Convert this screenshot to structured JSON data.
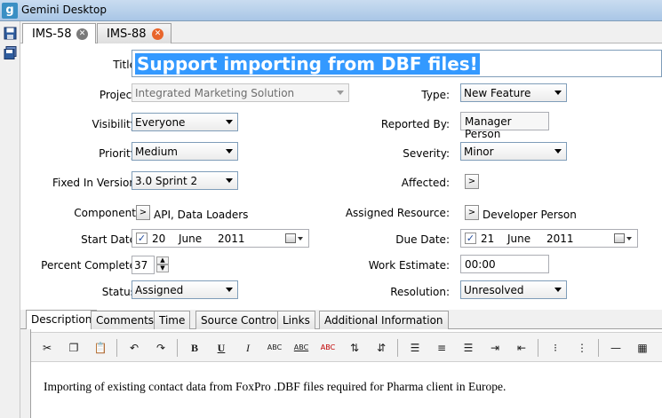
{
  "window": {
    "title": "Gemini Desktop",
    "logo_letter": "g"
  },
  "doc_tabs": [
    {
      "label": "IMS-58",
      "active": true
    },
    {
      "label": "IMS-88",
      "active": false
    }
  ],
  "form": {
    "title_label": "Title:",
    "title_value": "Support importing from DBF files!",
    "project": {
      "label": "Project:",
      "value": "Integrated Marketing Solution"
    },
    "type": {
      "label": "Type:",
      "value": "New Feature"
    },
    "visibility": {
      "label": "Visibility:",
      "value": "Everyone"
    },
    "reported_by": {
      "label": "Reported By:",
      "value": "Manager Person"
    },
    "priority": {
      "label": "Priority:",
      "value": "Medium"
    },
    "severity": {
      "label": "Severity:",
      "value": "Minor"
    },
    "fixed_in_version": {
      "label": "Fixed In Version:",
      "value": "3.0 Sprint 2"
    },
    "affected": {
      "label": "Affected:",
      "button": ">"
    },
    "component": {
      "label": "Component:",
      "button": ">",
      "value": "API, Data Loaders"
    },
    "assigned_resource": {
      "label": "Assigned Resource:",
      "button": ">",
      "value": "Developer Person"
    },
    "start_date": {
      "label": "Start Date:",
      "checked": "✓",
      "day": "20",
      "month": "June",
      "year": "2011"
    },
    "due_date": {
      "label": "Due Date:",
      "checked": "✓",
      "day": "21",
      "month": "June",
      "year": "2011"
    },
    "percent_complete": {
      "label": "Percent Complete:",
      "value": "37"
    },
    "work_estimate": {
      "label": "Work Estimate:",
      "value": "00:00"
    },
    "status": {
      "label": "Status:",
      "value": "Assigned"
    },
    "resolution": {
      "label": "Resolution:",
      "value": "Unresolved"
    }
  },
  "sub_tabs": [
    {
      "label": "Description",
      "active": true
    },
    {
      "label": "Comments",
      "active": false
    },
    {
      "label": "Time",
      "active": false
    },
    {
      "label": "Source Control",
      "active": false
    },
    {
      "label": "Links",
      "active": false
    },
    {
      "label": "Additional Information",
      "active": false
    }
  ],
  "toolbar": {
    "icons": [
      "cut-icon",
      "copy-icon",
      "paste-icon",
      "undo-icon",
      "redo-icon",
      "bold-icon",
      "underline-icon",
      "italic-icon",
      "strikethrough-icon",
      "font-color-icon",
      "highlight-icon",
      "sort-ascending-icon",
      "sort-descending-icon",
      "align-left-icon",
      "align-center-icon",
      "align-right-icon",
      "indent-icon",
      "outdent-icon",
      "bulleted-list-icon",
      "numbered-list-icon",
      "horizontal-rule-icon",
      "table-icon"
    ],
    "bold": "B",
    "underline": "U",
    "italic": "I",
    "abc": "ABC"
  },
  "description_text": "Importing of existing contact data from FoxPro .DBF files required for Pharma client in Europe.",
  "colors": {
    "selection": "#3399ff",
    "close_active": "#7a7a7a",
    "close_inactive": "#e8652b"
  }
}
